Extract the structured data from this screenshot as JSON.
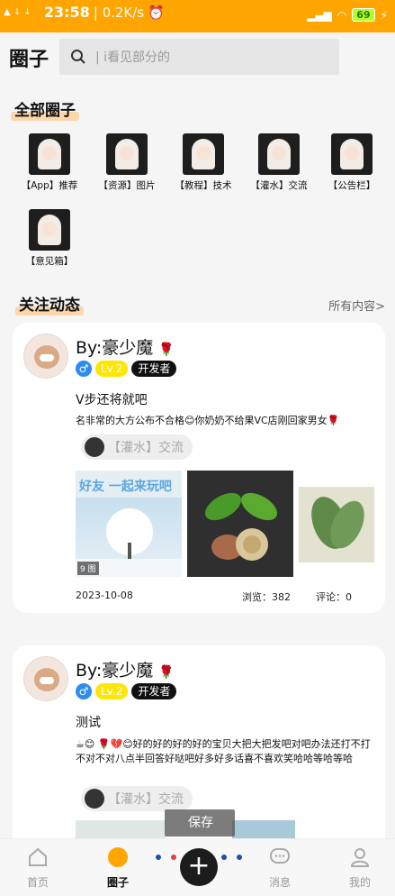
{
  "statusbar": {
    "time": "23:58",
    "speed": "| 0.2K/s",
    "battery": "69"
  },
  "header": {
    "title": "圈子",
    "search_placeholder": "| i看见部分的"
  },
  "all_circles": {
    "title": "全部圈子",
    "items": [
      {
        "label": "【App】推荐"
      },
      {
        "label": "【资源】图片"
      },
      {
        "label": "【教程】技术"
      },
      {
        "label": "【灌水】交流"
      },
      {
        "label": "【公告栏】"
      },
      {
        "label": "【意见箱】"
      }
    ]
  },
  "following": {
    "title": "关注动态",
    "more": "所有内容>"
  },
  "posts": [
    {
      "author": "By:豪少魔",
      "gender": "♂",
      "level": "Lv.2",
      "role": "开发者",
      "title": "V步还将就吧",
      "body": "名非常的大方公布不合格😊你奶奶不给果VC店刚回家男女🌹",
      "tag": "【灌水】交流",
      "image_count": "9 图",
      "date": "2023-10-08",
      "views": "浏览：382",
      "comments": "评论：0"
    },
    {
      "author": "By:豪少魔",
      "gender": "♂",
      "level": "Lv.2",
      "role": "开发者",
      "title": "测试",
      "body": "☕😊 🌹💔😊好的好的好的好的宝贝大把大把发吧对吧办法还打不打不对不对八点半回答好哒吧好多好多话喜不喜欢笑哈哈等哈等哈",
      "tag": "【灌水】交流"
    }
  ],
  "overlay": {
    "save": "保存"
  },
  "tabs": [
    {
      "label": "首页",
      "icon": "home-icon"
    },
    {
      "label": "圈子",
      "icon": "circle-icon"
    },
    {
      "label": "消息",
      "icon": "message-icon"
    },
    {
      "label": "我的",
      "icon": "profile-icon"
    }
  ],
  "colors": {
    "accent": "#ffa500",
    "lv_badge": "#ffe600",
    "dev_badge": "#111111",
    "gender_badge": "#2d8cf0"
  }
}
